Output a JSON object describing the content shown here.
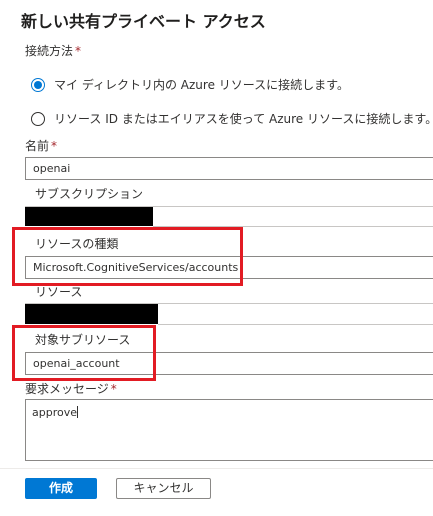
{
  "page": {
    "title": "新しい共有プライベート アクセス"
  },
  "connection": {
    "label": "接続方法",
    "required_mark": "*",
    "options": [
      {
        "label": "マイ ディレクトリ内の Azure リソースに接続します。",
        "selected": true
      },
      {
        "label": "リソース ID またはエイリアスを使って Azure リソースに接続します。",
        "selected": false
      }
    ]
  },
  "name": {
    "label": "名前",
    "required_mark": "*",
    "value": "openai"
  },
  "subscription": {
    "label": "サブスクリプション",
    "value_redacted": true
  },
  "resource_type": {
    "label": "リソースの種類",
    "value": "Microsoft.CognitiveServices/accounts"
  },
  "resource": {
    "label": "リソース",
    "value_redacted": true
  },
  "target_subresource": {
    "label": "対象サブリソース",
    "value": "openai_account"
  },
  "request_message": {
    "label": "要求メッセージ",
    "required_mark": "*",
    "value": "approve"
  },
  "actions": {
    "create_label": "作成",
    "cancel_label": "キャンセル"
  },
  "colors": {
    "accent": "#0078d4",
    "highlight": "#e21b23",
    "redaction": "#000000"
  }
}
